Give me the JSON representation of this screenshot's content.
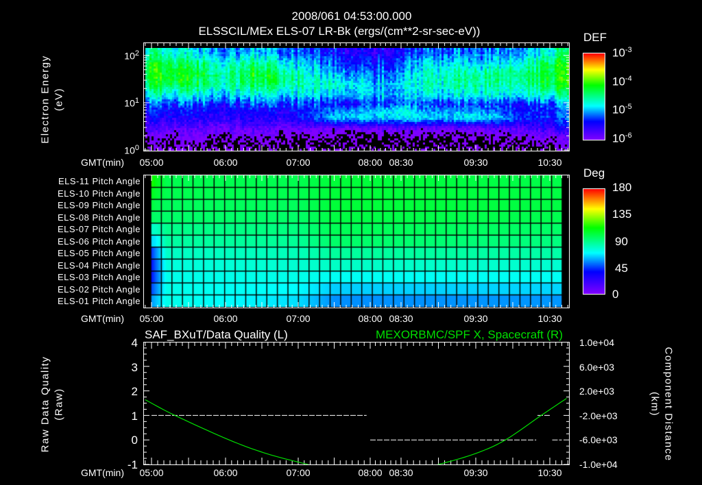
{
  "header": {
    "datetime": "2008/061 04:53:00.000",
    "panel1_title": "ELSSCIL/MEx ELS-07 LR-Bk  (ergs/(cm**2-sr-sec-eV))"
  },
  "x_axis": {
    "label": "GMT(min)",
    "ticks": [
      "05:00",
      "06:00",
      "07:00",
      "08:00",
      "08:30",
      "09:30",
      "10:30"
    ]
  },
  "colors": {
    "background": "#000000",
    "text": "#ffffff",
    "curve": "#00e000"
  },
  "chart_data": [
    {
      "type": "heatmap",
      "title": "ELSSCIL/MEx ELS-07 LR-Bk  (ergs/(cm**2-sr-sec-eV))",
      "ylabel": "Electron Energy",
      "yunit": "(eV)",
      "yscale": "log",
      "ylim": [
        1,
        145
      ],
      "yticks": [
        {
          "base": "10",
          "exp": "2"
        },
        {
          "base": "10",
          "exp": "1"
        },
        {
          "base": "10",
          "exp": "0"
        }
      ],
      "colorbar": {
        "label": "DEF",
        "scale": "log",
        "range": [
          -6,
          -3
        ],
        "ticks": [
          {
            "base": "10",
            "exp": "-3"
          },
          {
            "base": "10",
            "exp": "-4"
          },
          {
            "base": "10",
            "exp": "-5"
          },
          {
            "base": "10",
            "exp": "-6"
          }
        ]
      },
      "times": [
        "04:54",
        "05:15",
        "05:40",
        "06:00",
        "06:20",
        "06:45",
        "07:10",
        "07:30",
        "07:50",
        "08:00",
        "08:30",
        "08:50",
        "09:10",
        "09:30",
        "09:50",
        "10:10",
        "10:30",
        "10:45"
      ],
      "energies_eV": [
        1.2,
        2,
        3,
        5,
        7,
        10,
        15,
        25,
        40,
        70,
        120
      ],
      "log10_def": [
        [
          -6.2,
          -6.0,
          -5.8,
          -5.5,
          -5.4,
          -5.2,
          -4.8,
          -4.4,
          -4.2,
          -4.3,
          -4.6
        ],
        [
          -6.2,
          -6.0,
          -5.8,
          -5.5,
          -5.4,
          -5.2,
          -4.8,
          -4.3,
          -4.1,
          -4.3,
          -4.7
        ],
        [
          -6.2,
          -6.0,
          -5.8,
          -5.5,
          -5.4,
          -5.2,
          -4.8,
          -4.4,
          -4.3,
          -4.5,
          -4.9
        ],
        [
          -6.3,
          -6.1,
          -5.9,
          -5.6,
          -5.5,
          -5.4,
          -5.0,
          -4.7,
          -4.6,
          -4.8,
          -5.1
        ],
        [
          -6.2,
          -6.0,
          -5.8,
          -5.5,
          -5.4,
          -5.2,
          -4.8,
          -4.3,
          -4.2,
          -4.4,
          -4.9
        ],
        [
          -6.3,
          -6.1,
          -5.9,
          -5.6,
          -5.5,
          -5.2,
          -4.9,
          -4.5,
          -4.4,
          -4.7,
          -5.1
        ],
        [
          -6.4,
          -6.2,
          -5.9,
          -5.3,
          -5.3,
          -5.3,
          -4.9,
          -4.7,
          -4.8,
          -5.0,
          -5.3
        ],
        [
          -6.4,
          -6.2,
          -5.9,
          -4.9,
          -5.1,
          -5.4,
          -5.0,
          -4.7,
          -4.9,
          -5.2,
          -5.4
        ],
        [
          -6.4,
          -6.2,
          -5.9,
          -4.9,
          -5.0,
          -5.4,
          -4.9,
          -4.8,
          -5.0,
          -5.3,
          -5.5
        ],
        [
          -6.4,
          -6.2,
          -5.9,
          -4.9,
          -5.0,
          -5.3,
          -5.0,
          -5.0,
          -5.2,
          -5.4,
          -5.6
        ],
        [
          -6.3,
          -6.1,
          -5.8,
          -4.8,
          -4.7,
          -5.0,
          -4.9,
          -4.8,
          -4.9,
          -5.1,
          -5.3
        ],
        [
          -6.4,
          -6.2,
          -5.9,
          -4.9,
          -5.1,
          -5.3,
          -4.9,
          -4.7,
          -4.7,
          -4.9,
          -5.2
        ],
        [
          -6.4,
          -6.2,
          -5.9,
          -4.9,
          -5.0,
          -5.3,
          -4.8,
          -4.6,
          -4.6,
          -4.8,
          -5.1
        ],
        [
          -6.4,
          -6.2,
          -5.9,
          -4.8,
          -5.0,
          -5.3,
          -4.8,
          -4.6,
          -4.6,
          -4.9,
          -5.2
        ],
        [
          -6.3,
          -6.1,
          -5.8,
          -5.0,
          -5.2,
          -5.3,
          -4.8,
          -4.6,
          -4.5,
          -4.8,
          -5.1
        ],
        [
          -6.2,
          -6.0,
          -5.7,
          -5.3,
          -5.4,
          -5.3,
          -4.8,
          -4.5,
          -4.4,
          -4.6,
          -5.0
        ],
        [
          -6.2,
          -6.0,
          -5.6,
          -5.3,
          -5.3,
          -5.2,
          -4.7,
          -4.3,
          -4.2,
          -4.3,
          -4.7
        ],
        [
          -6.1,
          -5.9,
          -5.5,
          -5.2,
          -5.2,
          -5.0,
          -4.6,
          -4.2,
          -4.1,
          -4.2,
          -4.5
        ]
      ]
    },
    {
      "type": "heatmap",
      "title": "Pitch Angle",
      "rows": [
        "ELS-11 Pitch Angle",
        "ELS-10 Pitch Angle",
        "ELS-09 Pitch Angle",
        "ELS-08 Pitch Angle",
        "ELS-07 Pitch Angle",
        "ELS-06 Pitch Angle",
        "ELS-05 Pitch Angle",
        "ELS-04 Pitch Angle",
        "ELS-03 Pitch Angle",
        "ELS-02 Pitch Angle",
        "ELS-01 Pitch Angle"
      ],
      "colorbar": {
        "label": "Deg",
        "range": [
          0,
          180
        ],
        "ticks": [
          "180",
          "135",
          "90",
          "45",
          "0"
        ]
      },
      "times": [
        "04:55",
        "05:03",
        "05:12",
        "07:00",
        "07:30",
        "10:40"
      ],
      "values_deg": [
        [
          128,
          110,
          100,
          100,
          104,
          101
        ],
        [
          115,
          105,
          100,
          100,
          104,
          102
        ],
        [
          108,
          100,
          98,
          98,
          104,
          102
        ],
        [
          100,
          96,
          96,
          96,
          102,
          100
        ],
        [
          78,
          80,
          90,
          92,
          99,
          96
        ],
        [
          62,
          68,
          86,
          88,
          96,
          92
        ],
        [
          30,
          55,
          80,
          82,
          87,
          85
        ],
        [
          25,
          50,
          76,
          78,
          80,
          78
        ],
        [
          25,
          50,
          74,
          74,
          72,
          72
        ],
        [
          35,
          55,
          74,
          70,
          64,
          65
        ],
        [
          50,
          62,
          74,
          66,
          56,
          57
        ]
      ]
    },
    {
      "type": "line",
      "left_title": "SAF_BXuT/Data Quality (L)",
      "right_title": "MEXORBMC/SPF X, Spacecraft (R)",
      "left_ylabel": "Raw Data Quality",
      "left_yunit": "(Raw)",
      "right_ylabel": "Component Distance",
      "right_yunit": "(km)",
      "left_ylim": [
        -1,
        4
      ],
      "right_ylim": [
        -10000,
        10000
      ],
      "left_yticks": [
        "4",
        "3",
        "2",
        "1",
        "0",
        "-1"
      ],
      "right_yticks": [
        "1.0e+04",
        "6.0e+03",
        "2.0e+03",
        "-2.0e+03",
        "-6.0e+03",
        "-1.0e+04"
      ],
      "quality_series": [
        {
          "start": "05:00",
          "end": "07:57",
          "value": 1
        },
        {
          "start": "08:00",
          "end": "10:19",
          "value": 0
        },
        {
          "start": "10:20",
          "end": "10:31",
          "value": 1
        },
        {
          "start": "10:32",
          "end": "10:40",
          "value": 0
        }
      ],
      "spacecraft_x_km": {
        "times": [
          "04:55",
          "05:19",
          "06:03",
          "06:35",
          "07:08",
          "07:35",
          "08:00",
          "08:30",
          "09:00",
          "09:30",
          "09:54",
          "10:23",
          "10:44"
        ],
        "values": [
          560,
          -2000,
          -6000,
          -8300,
          -10000,
          -11300,
          -11800,
          -11300,
          -10000,
          -8200,
          -6000,
          -2000,
          780
        ]
      }
    }
  ]
}
